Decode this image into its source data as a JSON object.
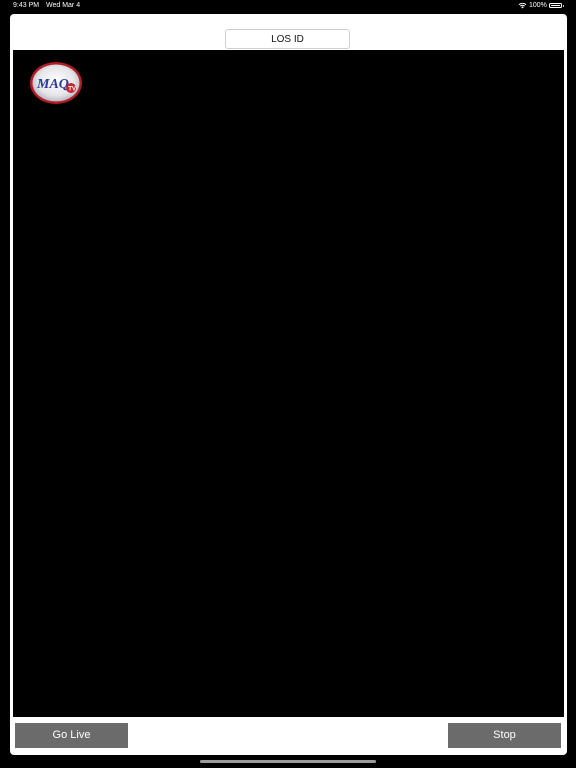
{
  "status_bar": {
    "time": "9:43 PM",
    "date": "Wed Mar 4",
    "battery": "100%",
    "icons": [
      "wifi-icon",
      "battery-icon"
    ]
  },
  "header": {
    "los_field_value": "LOS ID"
  },
  "video": {
    "logo_text": "MAQ",
    "logo_badge": "TV"
  },
  "controls": {
    "go_live_label": "Go Live",
    "stop_label": "Stop"
  },
  "colors": {
    "button_bg": "#6b6b6b",
    "video_bg": "#000000",
    "panel_bg": "#ffffff"
  }
}
